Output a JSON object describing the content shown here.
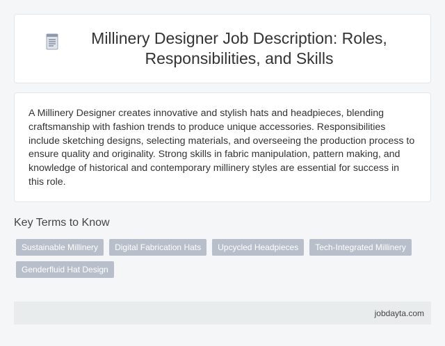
{
  "header": {
    "icon": "document-icon",
    "title": "Millinery Designer Job Description: Roles, Responsibilities, and Skills"
  },
  "description": "A Millinery Designer creates innovative and stylish hats and headpieces, blending craftsmanship with fashion trends to produce unique accessories. Responsibilities include sketching designs, selecting materials, and overseeing the production process to ensure quality and originality. Strong skills in fabric manipulation, pattern making, and knowledge of historical and contemporary millinery styles are essential for success in this role.",
  "key_terms": {
    "heading": "Key Terms to Know",
    "tags": [
      "Sustainable Millinery",
      "Digital Fabrication Hats",
      "Upcycled Headpieces",
      "Tech-Integrated Millinery",
      "Genderfluid Hat Design"
    ]
  },
  "footer": {
    "site": "jobdayta.com"
  },
  "colors": {
    "tag_bg": "#b8bfca",
    "footer_bg": "#e8ecec",
    "page_bg": "#f4f6f7"
  }
}
